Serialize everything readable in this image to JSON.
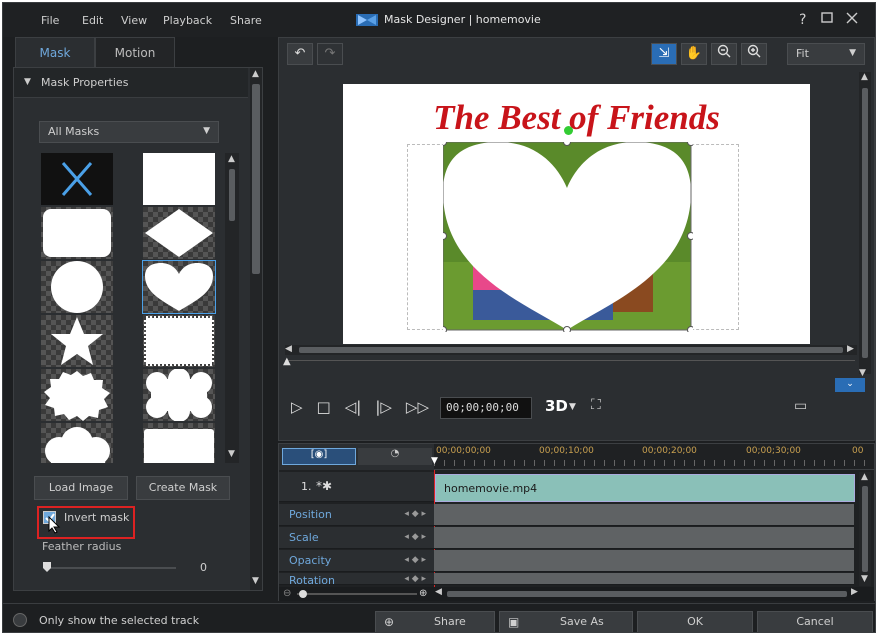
{
  "menu": [
    "File",
    "Edit",
    "View",
    "Playback",
    "Share"
  ],
  "window": {
    "title": "Mask Designer | homemovie",
    "help": "?"
  },
  "tabs": {
    "mask": "Mask",
    "motion": "Motion"
  },
  "mask_properties": {
    "heading": "Mask Properties",
    "dropdown_value": "All Masks",
    "load_image": "Load Image",
    "create_mask": "Create Mask",
    "invert_mask": "Invert mask",
    "feather_label": "Feather radius",
    "feather_value": "0"
  },
  "preview": {
    "zoom": "Fit",
    "overlay_title": "The Best of Friends"
  },
  "playback": {
    "timecode": "00;00;00;00",
    "mode_3d": "3D"
  },
  "timeline": {
    "ruler": [
      "00;00;00;00",
      "00;00;10;00",
      "00;00;20;00",
      "00;00;30;00",
      "00"
    ],
    "track_number": "1.",
    "clip_name": "homemovie.mp4",
    "rows": [
      "Position",
      "Scale",
      "Opacity",
      "Rotation"
    ]
  },
  "bottom": {
    "only_selected": "Only show the selected track",
    "share": "Share",
    "save_as": "Save As",
    "ok": "OK",
    "cancel": "Cancel"
  },
  "colors": {
    "accent": "#6fa8dc",
    "title_red": "#c8141a",
    "highlight": "#d22"
  }
}
